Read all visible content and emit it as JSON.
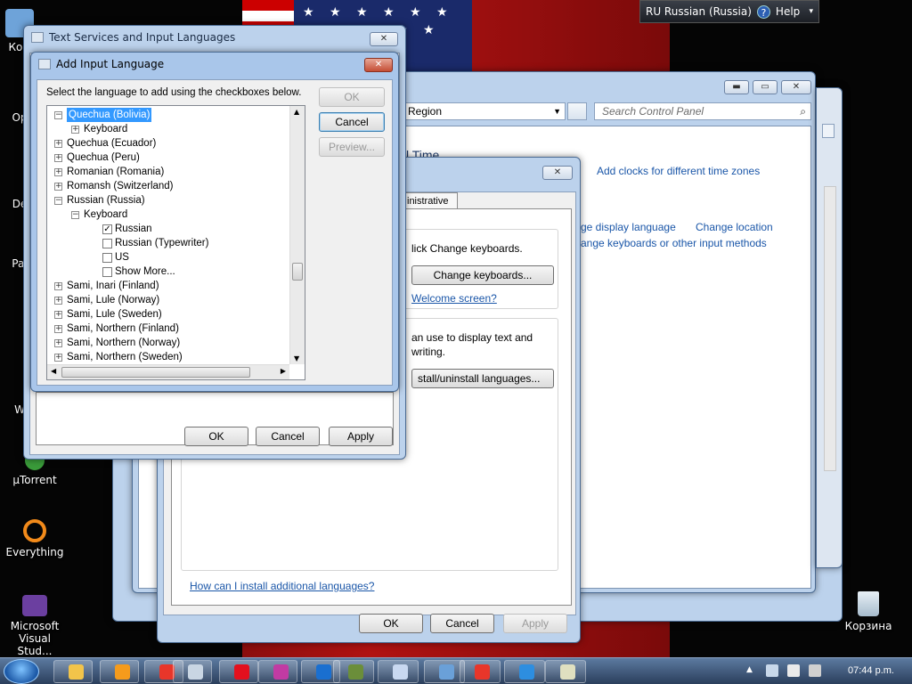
{
  "langbar": {
    "lang": "RU Russian (Russia)",
    "help": "Help"
  },
  "desktop_icons": [
    {
      "label": "Ком"
    },
    {
      "label": "Op"
    },
    {
      "label": "De"
    },
    {
      "label": "Pal"
    },
    {
      "label": "W"
    },
    {
      "label": "µTorrent"
    },
    {
      "label": "Everything"
    },
    {
      "label": "Microsoft Visual Stud..."
    },
    {
      "label": "Корзина"
    }
  ],
  "control_panel": {
    "breadcrumb": "Region",
    "search_placeholder": "Search Control Panel",
    "partial_heading": "l Time",
    "links": [
      "Add clocks for different time zones",
      "ge display language",
      "Change location",
      "ange keyboards or other input methods"
    ]
  },
  "region_dialog": {
    "tab": "inistrative",
    "text1": "lick Change keyboards.",
    "change_keyboards": "Change keyboards...",
    "welcome": "Welcome screen?",
    "text2a": "an use to display text and",
    "text2b": "writing.",
    "install": "stall/uninstall languages...",
    "how_link": "How can I install additional languages?",
    "ok": "OK",
    "cancel": "Cancel",
    "apply": "Apply"
  },
  "tsil": {
    "title": "Text Services and Input Languages",
    "ok": "OK",
    "cancel": "Cancel",
    "apply": "Apply"
  },
  "add_lang": {
    "title": "Add Input Language",
    "instruction": "Select the language to add using the checkboxes below.",
    "ok": "OK",
    "cancel": "Cancel",
    "preview": "Preview...",
    "tree": [
      {
        "label": "Quechua (Bolivia)",
        "level": 0,
        "type": "lang",
        "state": "open",
        "selected": true
      },
      {
        "label": "Keyboard",
        "level": 1,
        "type": "group",
        "state": "closed"
      },
      {
        "label": "Quechua (Ecuador)",
        "level": 0,
        "type": "lang",
        "state": "closed"
      },
      {
        "label": "Quechua (Peru)",
        "level": 0,
        "type": "lang",
        "state": "closed"
      },
      {
        "label": "Romanian (Romania)",
        "level": 0,
        "type": "lang",
        "state": "closed"
      },
      {
        "label": "Romansh (Switzerland)",
        "level": 0,
        "type": "lang",
        "state": "closed"
      },
      {
        "label": "Russian (Russia)",
        "level": 0,
        "type": "lang",
        "state": "open"
      },
      {
        "label": "Keyboard",
        "level": 1,
        "type": "group",
        "state": "open"
      },
      {
        "label": "Russian",
        "level": 2,
        "type": "check",
        "checked": true
      },
      {
        "label": "Russian (Typewriter)",
        "level": 2,
        "type": "check",
        "checked": false
      },
      {
        "label": "US",
        "level": 2,
        "type": "check",
        "checked": false
      },
      {
        "label": "Show More...",
        "level": 2,
        "type": "check",
        "checked": false
      },
      {
        "label": "Sami, Inari (Finland)",
        "level": 0,
        "type": "lang",
        "state": "closed"
      },
      {
        "label": "Sami, Lule (Norway)",
        "level": 0,
        "type": "lang",
        "state": "closed"
      },
      {
        "label": "Sami, Lule (Sweden)",
        "level": 0,
        "type": "lang",
        "state": "closed"
      },
      {
        "label": "Sami, Northern (Finland)",
        "level": 0,
        "type": "lang",
        "state": "closed"
      },
      {
        "label": "Sami, Northern (Norway)",
        "level": 0,
        "type": "lang",
        "state": "closed"
      },
      {
        "label": "Sami, Northern (Sweden)",
        "level": 0,
        "type": "lang",
        "state": "closed"
      }
    ]
  },
  "taskbar": {
    "clock": "07:44 p.m.",
    "items": [
      {
        "name": "explorer",
        "color": "#f2c44a"
      },
      {
        "name": "media-player",
        "color": "#f59b1c"
      },
      {
        "name": "yandex",
        "color": "#e8362a"
      },
      {
        "name": "ball",
        "color": "#c9d6e3"
      },
      {
        "name": "opera",
        "color": "#e3101e"
      },
      {
        "name": "opera-dev",
        "color": "#c13ba3"
      },
      {
        "name": "app-o",
        "color": "#1a6fd0"
      },
      {
        "name": "minecraft",
        "color": "#6b8e3a"
      },
      {
        "name": "paint",
        "color": "#c8d8f0"
      },
      {
        "name": "control",
        "color": "#6aa0d8"
      },
      {
        "name": "yandex-browser",
        "color": "#e8362a"
      },
      {
        "name": "ie",
        "color": "#2d8ee0"
      },
      {
        "name": "dialog",
        "color": "#e0e0c0"
      }
    ]
  }
}
